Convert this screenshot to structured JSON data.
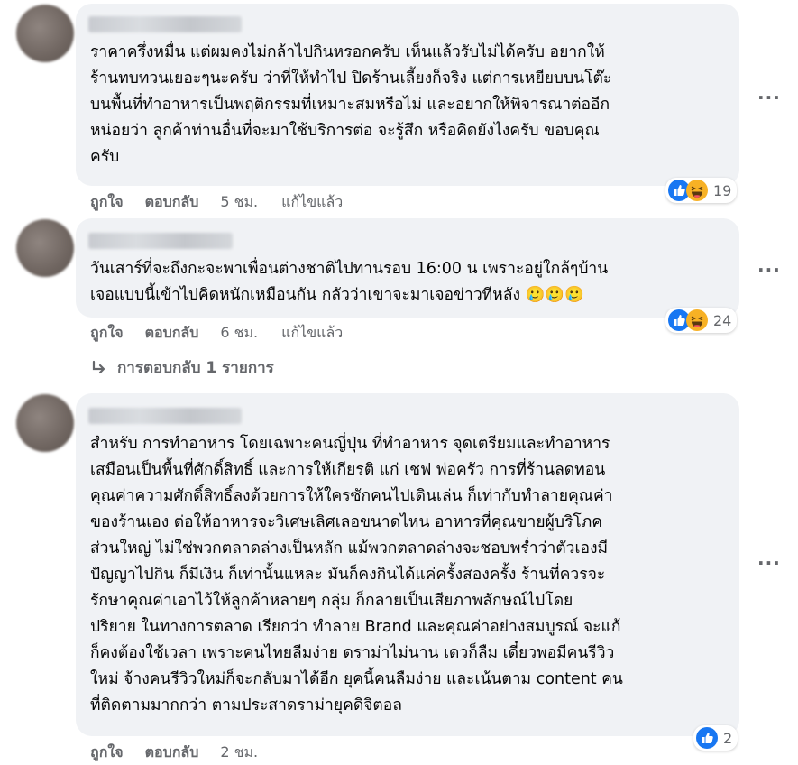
{
  "comments": [
    {
      "text": "ราคาครึ่งหมื่น แต่ผมคงไม่กล้าไปกินหรอกครับ เห็นแล้วรับไม่ได้ครับ อยากให้\nร้านทบทวนเยอะๆนะครับ ว่าที่ให้ทำไป ปิดร้านเลี้ยงก็จริง แต่การเหยียบบนโต๊ะ\nบนพื้นที่ทำอาหารเป็นพฤติกรรมที่เหมาะสมหรือไม่ และอยากให้พิจารณาต่ออีก\nหน่อยว่า ลูกค้าท่านอื่นที่จะมาใช้บริการต่อ จะรู้สึก หรือคิดยังไงครับ ขอบคุณ\nครับ",
      "like": "ถูกใจ",
      "reply": "ตอบกลับ",
      "time": "5 ชม.",
      "edited": "แก้ไขแล้ว",
      "reaction_count": "19"
    },
    {
      "text": "วันเสาร์ที่จะถึงกะจะพาเพื่อนต่างชาติไปทานรอบ 16:00 น เพราะอยู่ใกล้ๆบ้าน\nเจอแบบนี้เข้าไปคิดหนักเหมือนกัน กลัวว่าเขาจะมาเจอข่าวทีหลัง 🥲🥲🥲",
      "like": "ถูกใจ",
      "reply": "ตอบกลับ",
      "time": "6 ชม.",
      "edited": "แก้ไขแล้ว",
      "reaction_count": "24",
      "replies_link": "การตอบกลับ 1 รายการ"
    },
    {
      "text": "สำหรับ การทำอาหาร โดยเฉพาะคนญี่ปุ่น ที่ทำอาหาร จุดเตรียมและทำอาหาร\nเสมือนเป็นพื้นที่ศักดิ์สิทธิ์ และการให้เกียรติ แก่ เชฟ พ่อครัว การที่ร้านลดทอน\nคุณค่าความศักดิ์สิทธิ์ลงด้วยการให้ใครซักคนไปเดินเล่น ก็เท่ากับทำลายคุณค่า\nของร้านเอง ต่อให้อาหารจะวิเศษเลิศเลอขนาดไหน อาหารที่คุณขายผู้บริโภค\nส่วนใหญ่ ไม่ใช่พวกตลาดล่างเป็นหลัก แม้พวกตลาดล่างจะชอบพร่ำว่าตัวเองมี\nปัญญาไปกิน ก็มีเงิน ก็เท่านั้นแหละ มันก็คงกินได้แค่ครั้งสองครั้ง ร้านที่ควรจะ\nรักษาคุณค่าเอาไว้ให้ลูกค้าหลายๆ กลุ่ม ก็กลายเป็นเสียภาพลักษณ์ไปโดย\nปริยาย ในทางการตลาด เรียกว่า ทำลาย Brand และคุณค่าอย่างสมบูรณ์ จะแก้\nก็คงต้องใช้เวลา เพราะคนไทยลืมง่าย ดราม่าไม่นาน เดวก็ลืม เดี๋ยวพอมีคนรีวิว\nใหม่ จ้างคนรีวิวใหม่ก็จะกลับมาได้อีก ยุคนี้คนลืมง่าย และเน้นตาม content คน\nที่ติดตามมากกว่า ตามประสาดราม่ายุคดิจิตอล",
      "like": "ถูกใจ",
      "reply": "ตอบกลับ",
      "time": "2 ชม.",
      "reaction_count": "2"
    }
  ],
  "more_label": "···",
  "colors": {
    "like_blue": "#1877f2",
    "haha_yellow": "#f7b125",
    "bubble": "#f0f2f5",
    "meta": "#65676b"
  },
  "icons": [
    "like-icon",
    "haha-icon",
    "more-options-icon",
    "reply-arrow-icon"
  ]
}
